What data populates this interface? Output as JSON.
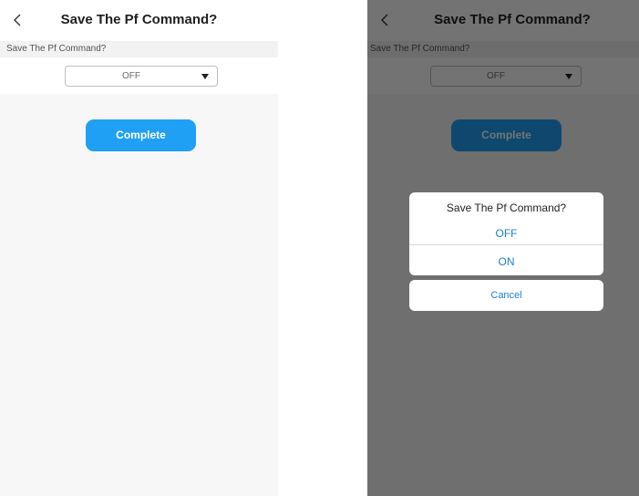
{
  "header": {
    "title": "Save The Pf Command?"
  },
  "field": {
    "label": "Save The Pf Command?",
    "selected_value": "OFF"
  },
  "actions": {
    "complete_label": "Complete"
  },
  "action_sheet": {
    "title": "Save The Pf Command?",
    "options": [
      "OFF",
      "ON"
    ],
    "cancel_label": "Cancel"
  },
  "colors": {
    "accent": "#1fa0f5",
    "link": "#1a7fd4",
    "overlay": "rgba(0,0,0,0.55)"
  },
  "icons": {
    "back": "chevron-left-icon",
    "dropdown": "caret-down-icon"
  }
}
